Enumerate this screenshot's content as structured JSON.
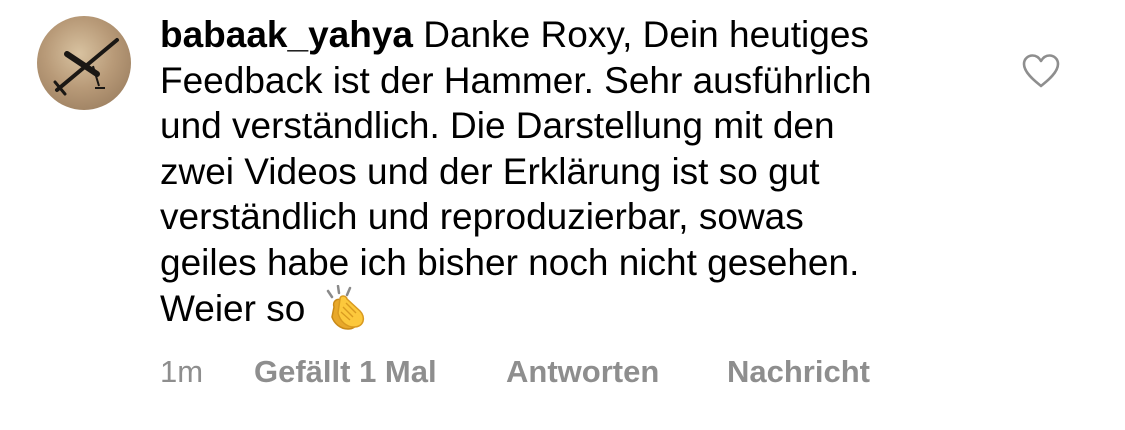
{
  "comment": {
    "username": "babaak_yahya",
    "text_lines": [
      "Danke Roxy, Dein heutiges",
      "Feedback ist der Hammer. Sehr ausführlich",
      "und verständlich. Die Darstellung mit den",
      "zwei Videos und der Erklärung ist so gut",
      "verständlich und reproduzierbar, sowas",
      "geiles habe ich bisher noch nicht gesehen.",
      "Weier so"
    ],
    "emoji": "clapping-hands",
    "avatar": "airplane-silhouette"
  },
  "footer": {
    "timestamp": "1m",
    "likes": "Gefällt 1 Mal",
    "reply_label": "Antworten",
    "message_label": "Nachricht"
  },
  "icons": {
    "like": "heart-outline-icon"
  },
  "colors": {
    "text": "#000000",
    "meta": "#8e8e8e",
    "icon": "#8e8e8e"
  }
}
